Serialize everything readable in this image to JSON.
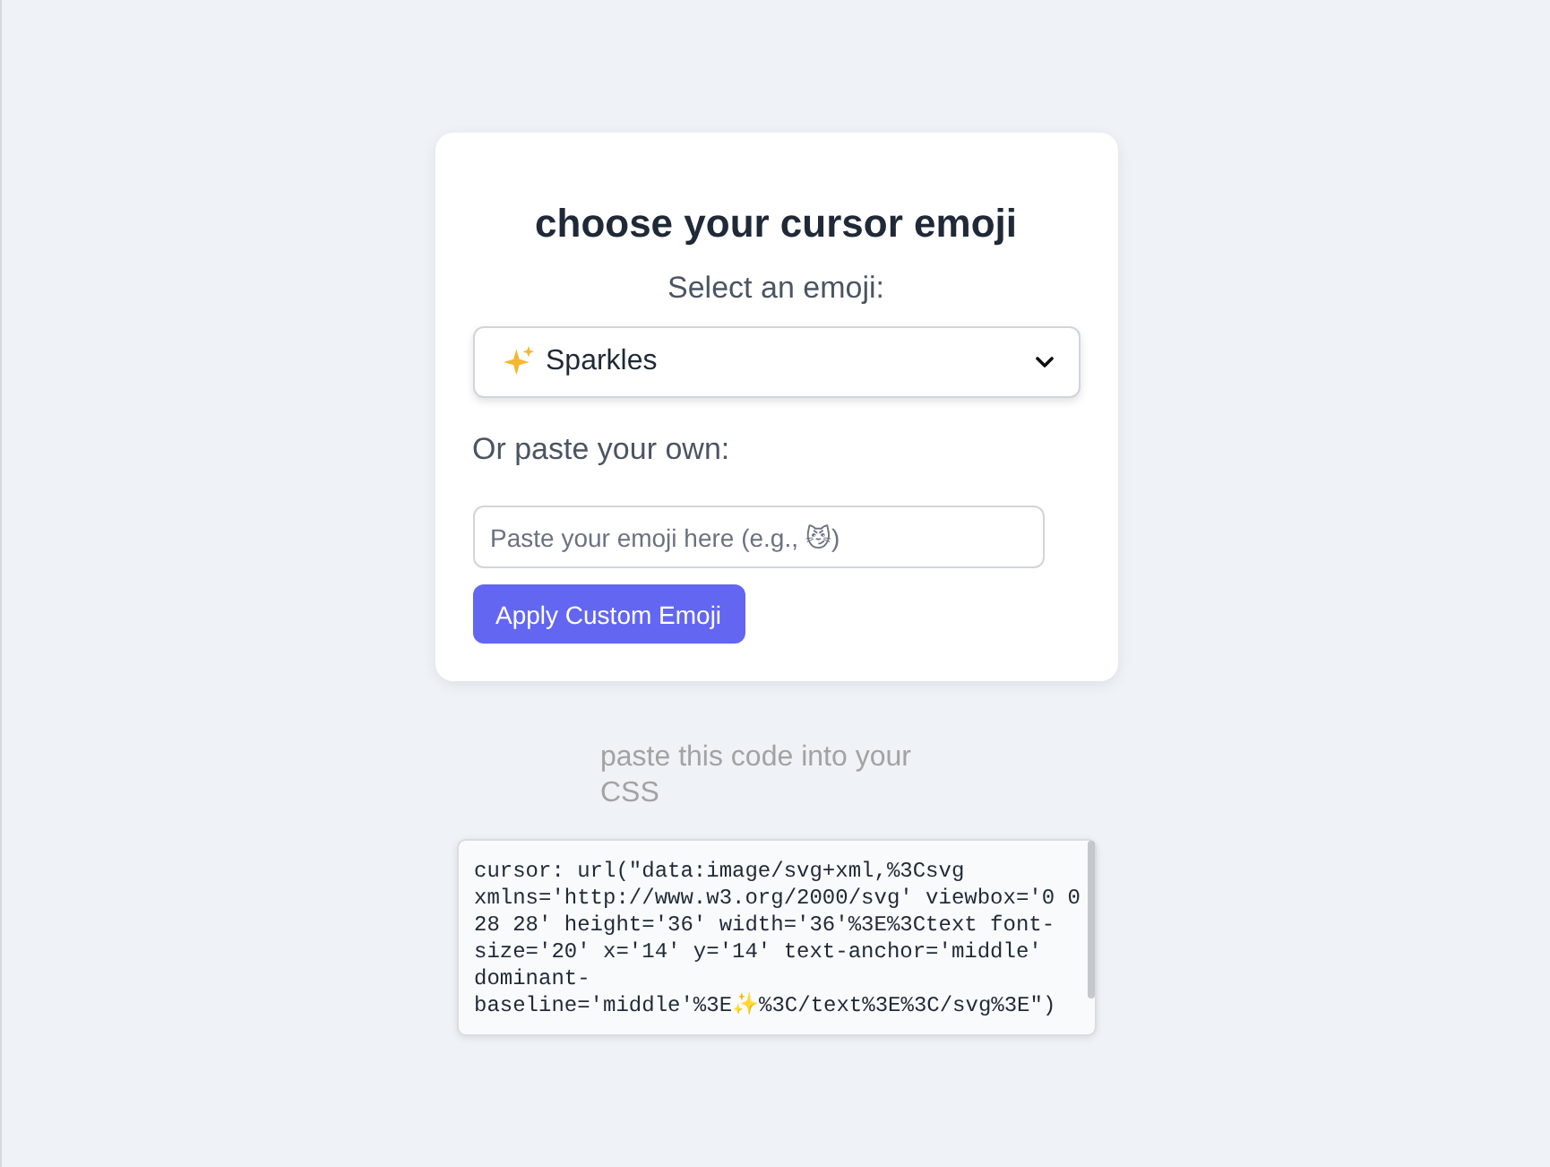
{
  "title": "choose your cursor emoji",
  "select_label": "Select an emoji:",
  "emoji_select": {
    "value": "Sparkles"
  },
  "custom_label": "Or paste your own:",
  "custom_input": {
    "placeholder": "Paste your emoji here (e.g., 😼)"
  },
  "apply_button": "Apply Custom Emoji",
  "code_label": "paste this code into your CSS",
  "code": "cursor: url(\"data:image/svg+xml,%3Csvg xmlns='http://www.w3.org/2000/svg' viewbox='0 0 28 28' height='36' width='36'%3E%3Ctext font-size='20' x='14' y='14' text-anchor='middle' dominant-baseline='middle'%3E✨%3C/text%3E%3C/svg%3E\")"
}
